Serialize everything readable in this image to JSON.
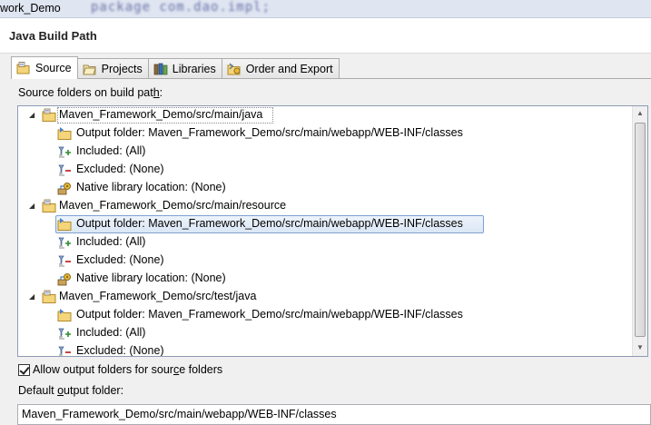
{
  "window": {
    "title": "work_Demo",
    "editor_snippet": "package com.dao.impl;"
  },
  "page": {
    "heading": "Java Build Path"
  },
  "tabs": [
    {
      "label": "Source",
      "icon": "source-folder-icon",
      "active": true
    },
    {
      "label": "Projects",
      "icon": "projects-icon",
      "active": false
    },
    {
      "label": "Libraries",
      "icon": "libraries-icon",
      "active": false
    },
    {
      "label": "Order and Export",
      "icon": "order-export-icon",
      "active": false
    }
  ],
  "source": {
    "label_pre": "Source folders on build pat",
    "label_mn": "h",
    "label_post": ":",
    "tree": [
      {
        "level": 0,
        "text": "Maven_Framework_Demo/src/main/java",
        "icon": "source-folder-icon",
        "expanded": true,
        "focused": true
      },
      {
        "level": 1,
        "text": "Output folder: Maven_Framework_Demo/src/main/webapp/WEB-INF/classes",
        "icon": "output-folder-icon"
      },
      {
        "level": 1,
        "text": "Included: (All)",
        "icon": "inclusion-filter-icon"
      },
      {
        "level": 1,
        "text": "Excluded: (None)",
        "icon": "exclusion-filter-icon"
      },
      {
        "level": 1,
        "text": "Native library location: (None)",
        "icon": "native-library-icon"
      },
      {
        "level": 0,
        "text": "Maven_Framework_Demo/src/main/resource",
        "icon": "source-folder-icon",
        "expanded": true
      },
      {
        "level": 1,
        "text": "Output folder: Maven_Framework_Demo/src/main/webapp/WEB-INF/classes",
        "icon": "output-folder-icon",
        "selected": true
      },
      {
        "level": 1,
        "text": "Included: (All)",
        "icon": "inclusion-filter-icon"
      },
      {
        "level": 1,
        "text": "Excluded: (None)",
        "icon": "exclusion-filter-icon"
      },
      {
        "level": 1,
        "text": "Native library location: (None)",
        "icon": "native-library-icon"
      },
      {
        "level": 0,
        "text": "Maven_Framework_Demo/src/test/java",
        "icon": "source-folder-icon",
        "expanded": true
      },
      {
        "level": 1,
        "text": "Output folder: Maven_Framework_Demo/src/main/webapp/WEB-INF/classes",
        "icon": "output-folder-icon"
      },
      {
        "level": 1,
        "text": "Included: (All)",
        "icon": "inclusion-filter-icon"
      },
      {
        "level": 1,
        "text": "Excluded: (None)",
        "icon": "exclusion-filter-icon"
      }
    ]
  },
  "allow_output": {
    "checked": true,
    "label_pre": "Allow output folders for sour",
    "label_mn": "c",
    "label_post": "e folders"
  },
  "default_output": {
    "label_pre": "Default ",
    "label_mn": "o",
    "label_post": "utput folder:",
    "value": "Maven_Framework_Demo/src/main/webapp/WEB-INF/classes"
  },
  "colors": {
    "selection_border": "#7da2ce",
    "tree_border": "#8e9bb5",
    "folder_yellow": "#e8c55a"
  }
}
